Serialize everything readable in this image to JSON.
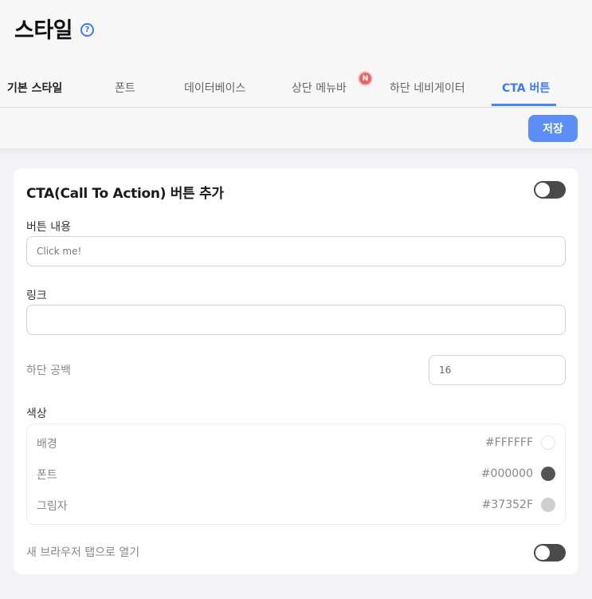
{
  "header": {
    "title": "스타일",
    "help_icon": "?"
  },
  "tabs": [
    {
      "label": "기본 스타일",
      "state": "bold"
    },
    {
      "label": "폰트",
      "state": "normal"
    },
    {
      "label": "데이터베이스",
      "state": "normal"
    },
    {
      "label": "상단 메뉴바",
      "state": "normal",
      "badge": "N"
    },
    {
      "label": "하단 네비게이터",
      "state": "normal"
    },
    {
      "label": "CTA 버튼",
      "state": "active"
    }
  ],
  "toolbar": {
    "save_label": "저장"
  },
  "cta": {
    "title": "CTA(Call To Action) 버튼 추가",
    "enabled": false,
    "button_text_label": "버튼 내용",
    "button_text_placeholder": "Click me!",
    "button_text_value": "",
    "link_label": "링크",
    "link_value": "",
    "bottom_margin_label": "하단 공백",
    "bottom_margin_value": "16",
    "color_label": "색상",
    "colors": [
      {
        "name": "배경",
        "hex": "#FFFFFF",
        "swatch": "#FFFFFF"
      },
      {
        "name": "폰트",
        "hex": "#000000",
        "swatch": "#555555"
      },
      {
        "name": "그림자",
        "hex": "#37352F",
        "swatch": "#cfcfcf"
      }
    ],
    "new_tab_label": "새 브라우저 탭으로 열기",
    "new_tab_enabled": false
  }
}
